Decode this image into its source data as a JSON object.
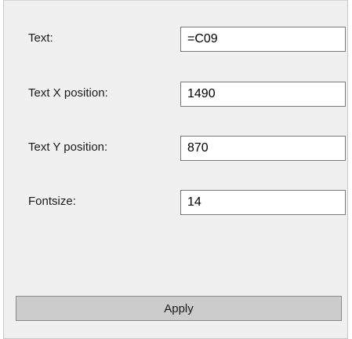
{
  "form": {
    "text": {
      "label": "Text:",
      "value": "=C09"
    },
    "text_x": {
      "label": "Text X position:",
      "value": "1490"
    },
    "text_y": {
      "label": "Text Y position:",
      "value": "870"
    },
    "fontsize": {
      "label": "Fontsize:",
      "value": "14"
    },
    "apply_label": "Apply"
  }
}
